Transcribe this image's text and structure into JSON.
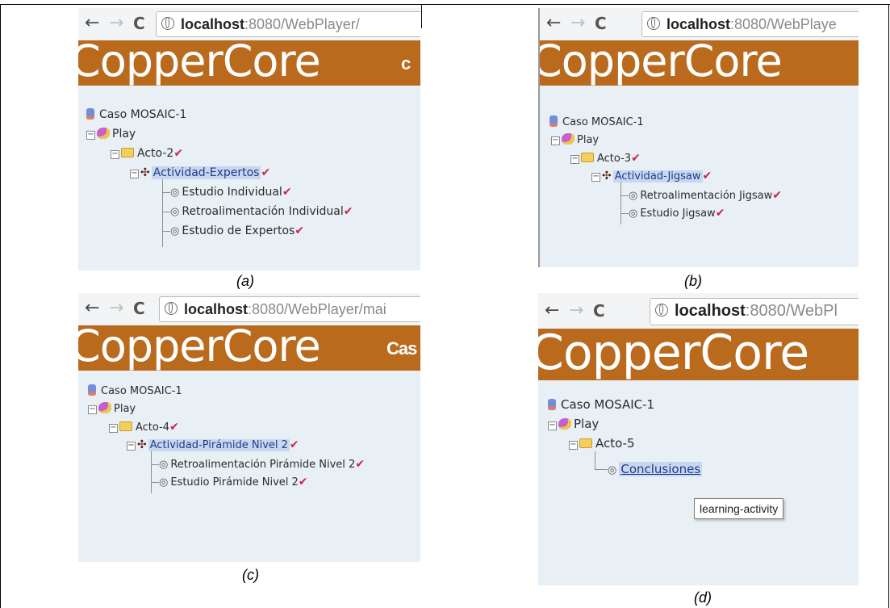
{
  "browser": {
    "back_icon": "←",
    "forward_icon": "→",
    "reload_icon": "C",
    "url_host": "localhost",
    "url_rest_a": ":8080/WebPlayer/",
    "url_rest_b": ":8080/WebPlaye",
    "url_rest_c": ":8080/WebPlayer/mai",
    "url_rest_d": ":8080/WebPl"
  },
  "brand": {
    "word": "CopperCore",
    "extra_a": "c",
    "extra_c": "Cas"
  },
  "tree_common": {
    "case": "Caso MOSAIC-1",
    "play": "Play"
  },
  "panel_a": {
    "act": "Acto-2",
    "activity": "Actividad-Expertos",
    "children": [
      "Estudio Individual",
      "Retroalimentación Individual",
      "Estudio de Expertos"
    ],
    "caption": "(a)"
  },
  "panel_b": {
    "act": "Acto-3",
    "activity": "Actividad-Jigsaw",
    "children": [
      "Retroalimentación Jigsaw",
      "Estudio Jigsaw"
    ],
    "caption": "(b)"
  },
  "panel_c": {
    "act": "Acto-4",
    "activity": "Actividad-Pirámide Nivel 2",
    "children": [
      "Retroalimentación Pirámide Nivel 2",
      "Estudio Pirámide Nivel 2"
    ],
    "caption": "(c)"
  },
  "panel_d": {
    "act": "Acto-5",
    "activity": "Conclusiones",
    "tooltip": "learning-activity",
    "caption": "(d)"
  },
  "glyphs": {
    "check": "✔",
    "minus": "−",
    "act_icon": "✣",
    "eye_icon": "◎"
  },
  "colors": {
    "brand_bg": "#b96a1d",
    "tree_bg": "#e8f0f5",
    "selection": "#c8d7f0",
    "check": "#d0214b"
  }
}
